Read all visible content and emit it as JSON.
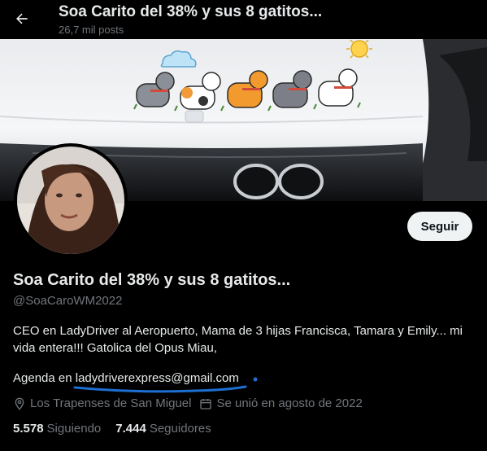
{
  "header": {
    "title": "Soa Carito del 38% y sus 8 gatitos...",
    "posts": "26,7 mil posts"
  },
  "profile": {
    "name": "Soa Carito del 38% y sus 8 gatitos...",
    "handle": "@SoaCaroWM2022",
    "follow_label": "Seguir",
    "bio": "CEO en LadyDriver al Aeropuerto, Mama de 3 hijas Francisca, Tamara y Emily... mi vida entera!!! Gatolica del Opus Miau,",
    "agenda_prefix": "Agenda en",
    "agenda_email": "ladydriverexpress@gmail.com",
    "location": "Los Trapenses de San Miguel",
    "joined": "Se unió en agosto de 2022",
    "following_count": "5.578",
    "following_label": "Siguiendo",
    "followers_count": "7.444",
    "followers_label": "Seguidores"
  },
  "icons": {
    "back": "arrow-left-icon",
    "location": "location-pin-icon",
    "calendar": "calendar-icon"
  },
  "colors": {
    "background": "#000000",
    "text": "#e7e9ea",
    "muted": "#71767b",
    "follow_button_bg": "#eff3f4",
    "annotation_underline": "#1d6fd1"
  }
}
